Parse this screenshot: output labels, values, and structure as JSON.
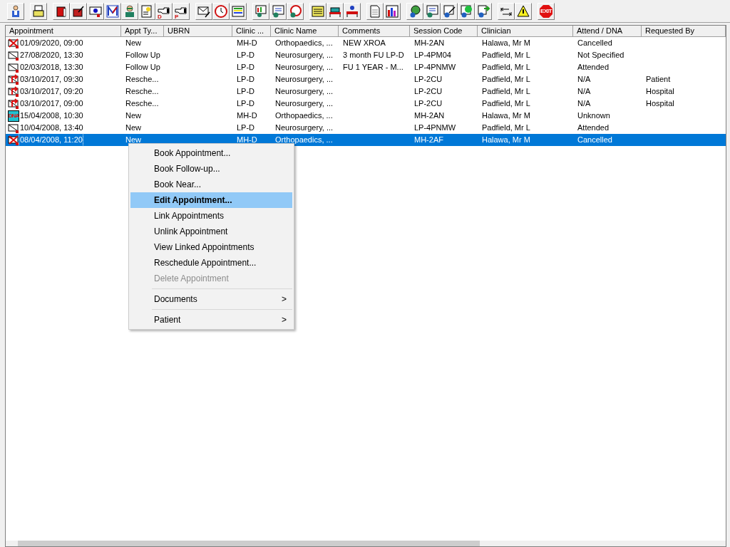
{
  "toolbar": {
    "groups": [
      [
        {
          "kind": "person"
        }
      ],
      [
        {
          "kind": "printer"
        }
      ],
      [
        {
          "kind": "book"
        },
        {
          "kind": "pen-book"
        },
        {
          "kind": "envelope-b"
        },
        {
          "kind": "m-letter"
        },
        {
          "kind": "nurse"
        },
        {
          "kind": "note-star"
        },
        {
          "kind": "hand",
          "label": "D"
        },
        {
          "kind": "hand",
          "label": "P"
        }
      ],
      [
        {
          "kind": "envelope-pen"
        },
        {
          "kind": "clock"
        },
        {
          "kind": "stripes"
        }
      ],
      [
        {
          "kind": "monitor-person"
        },
        {
          "kind": "form-person"
        },
        {
          "kind": "clock-person"
        }
      ],
      [
        {
          "kind": "notepad"
        },
        {
          "kind": "bed"
        },
        {
          "kind": "bed-person"
        }
      ],
      [
        {
          "kind": "document"
        },
        {
          "kind": "bar-chart"
        }
      ],
      [
        {
          "kind": "globe-person"
        },
        {
          "kind": "form-person"
        },
        {
          "kind": "form-pen-person"
        },
        {
          "kind": "grid-person"
        },
        {
          "kind": "arrow-person"
        }
      ],
      [
        {
          "kind": "arrows"
        },
        {
          "kind": "warning"
        }
      ],
      [
        {
          "kind": "exit",
          "label": "EXIT"
        }
      ]
    ]
  },
  "table": {
    "columns": [
      "Appointment",
      "Appt Ty...",
      "UBRN",
      "Clinic ...",
      "Clinic Name",
      "Comments",
      "Session Code",
      "Clinician",
      "Attend / DNA",
      "Requested By"
    ],
    "rows": [
      {
        "kind": "cancelled",
        "selected": false,
        "cells": [
          "01/09/2020, 09:00",
          "New",
          "",
          "MH-D",
          "Orthopaedics, ...",
          "NEW XROA",
          "MH-2AN",
          "Halawa, Mr M",
          "Cancelled",
          ""
        ]
      },
      {
        "kind": "envelope",
        "selected": false,
        "cells": [
          "27/08/2020, 13:30",
          "Follow Up",
          "",
          "LP-D",
          "Neurosurgery, ...",
          "3 month FU LP-D",
          "LP-4PM04",
          "Padfield, Mr L",
          "Not Specified",
          ""
        ]
      },
      {
        "kind": "envelope",
        "selected": false,
        "cells": [
          "02/03/2018, 13:30",
          "Follow Up",
          "",
          "LP-D",
          "Neurosurgery, ...",
          "FU 1 YEAR - M...",
          "LP-4PNMW",
          "Padfield, Mr L",
          "Attended",
          ""
        ]
      },
      {
        "kind": "rescheduled",
        "selected": false,
        "cells": [
          "03/10/2017, 09:30",
          "Resche...",
          "",
          "LP-D",
          "Neurosurgery, ...",
          "",
          "LP-2CU",
          "Padfield, Mr L",
          "N/A",
          "Patient"
        ]
      },
      {
        "kind": "rescheduled",
        "selected": false,
        "cells": [
          "03/10/2017, 09:20",
          "Resche...",
          "",
          "LP-D",
          "Neurosurgery, ...",
          "",
          "LP-2CU",
          "Padfield, Mr L",
          "N/A",
          "Hospital"
        ]
      },
      {
        "kind": "rescheduled",
        "selected": false,
        "cells": [
          "03/10/2017, 09:00",
          "Resche...",
          "",
          "LP-D",
          "Neurosurgery, ...",
          "",
          "LP-2CU",
          "Padfield, Mr L",
          "N/A",
          "Hospital"
        ]
      },
      {
        "kind": "dna",
        "icon_label": "DNA",
        "selected": false,
        "cells": [
          "15/04/2008, 10:30",
          "New",
          "",
          "MH-D",
          "Orthopaedics, ...",
          "",
          "MH-2AN",
          "Halawa, Mr M",
          "Unknown",
          ""
        ]
      },
      {
        "kind": "envelope",
        "selected": false,
        "cells": [
          "10/04/2008, 13:40",
          "New",
          "",
          "LP-D",
          "Neurosurgery, ...",
          "",
          "LP-4PNMW",
          "Padfield, Mr L",
          "Attended",
          ""
        ]
      },
      {
        "kind": "cancelled",
        "selected": true,
        "cells": [
          "08/04/2008, 11:20",
          "New",
          "",
          "MH-D",
          "Orthopaedics, ...",
          "",
          "MH-2AF",
          "Halawa, Mr M",
          "Cancelled",
          ""
        ]
      }
    ]
  },
  "context_menu": {
    "items": [
      {
        "kind": "item",
        "label": "Book Appointment...",
        "selected": false,
        "disabled": false
      },
      {
        "kind": "item",
        "label": "Book Follow-up...",
        "selected": false,
        "disabled": false
      },
      {
        "kind": "item",
        "label": "Book Near...",
        "selected": false,
        "disabled": false
      },
      {
        "kind": "item",
        "label": "Edit Appointment...",
        "selected": true,
        "disabled": false
      },
      {
        "kind": "item",
        "label": "Link Appointments",
        "selected": false,
        "disabled": false
      },
      {
        "kind": "item",
        "label": "Unlink Appointment",
        "selected": false,
        "disabled": false
      },
      {
        "kind": "item",
        "label": "View Linked Appointments",
        "selected": false,
        "disabled": false
      },
      {
        "kind": "item",
        "label": "Reschedule Appointment...",
        "selected": false,
        "disabled": false
      },
      {
        "kind": "item",
        "label": "Delete Appointment",
        "selected": false,
        "disabled": true
      },
      {
        "kind": "separator"
      },
      {
        "kind": "submenu",
        "label": "Documents",
        "arrow": ">",
        "selected": false,
        "disabled": false
      },
      {
        "kind": "separator"
      },
      {
        "kind": "submenu",
        "label": "Patient",
        "arrow": ">",
        "selected": false,
        "disabled": false
      }
    ]
  }
}
